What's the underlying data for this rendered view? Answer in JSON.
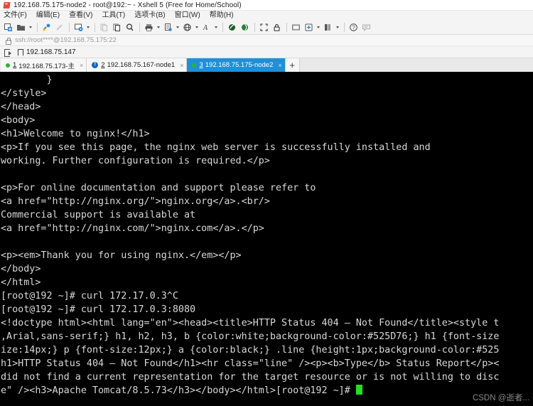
{
  "window": {
    "title": "192.168.75.175-node2 - root@192:~ - Xshell 5 (Free for Home/School)",
    "app_icon": "xshell-icon"
  },
  "menu": {
    "items": [
      {
        "label": "文件(F)",
        "name": "menu-file"
      },
      {
        "label": "编辑(E)",
        "name": "menu-edit"
      },
      {
        "label": "查看(V)",
        "name": "menu-view"
      },
      {
        "label": "工具(T)",
        "name": "menu-tools"
      },
      {
        "label": "选项卡(B)",
        "name": "menu-tabs"
      },
      {
        "label": "窗口(W)",
        "name": "menu-window"
      },
      {
        "label": "帮助(H)",
        "name": "menu-help"
      }
    ]
  },
  "toolbar": {
    "icons": [
      "new-session-icon",
      "open-folder-icon",
      "connect-icon",
      "disconnect-icon",
      "session-properties-icon",
      "copy-icon",
      "paste-icon",
      "find-icon",
      "print-icon",
      "log-icon",
      "globe-icon",
      "font-icon",
      "transfer-icon",
      "sftp-icon",
      "fullscreen-icon",
      "lock-icon",
      "compose-icon",
      "add-icon",
      "layout-icon",
      "help-icon",
      "chat-icon"
    ]
  },
  "address_bar": {
    "lock_icon": "lock-icon",
    "value": "ssh://root****@192.168.75.175:22",
    "placeholder": "ssh://host:port"
  },
  "bookmark_bar": {
    "open_icon": "open-session-icon",
    "flag_icon": "bookmark-flag-icon",
    "label": "192.168.75.147"
  },
  "tabs": {
    "add_label": "+",
    "close_label": "×",
    "items": [
      {
        "num": "1",
        "label": "192.168.75.173-主",
        "state": "connected",
        "active": false
      },
      {
        "num": "2",
        "label": "192.168.75.167-node1",
        "state": "alert",
        "active": false
      },
      {
        "num": "3",
        "label": "192.168.75.175-node2",
        "state": "connected",
        "active": true
      }
    ]
  },
  "terminal": {
    "background": "#000000",
    "foreground": "#d8d8d8",
    "cursor_color": "#22e022",
    "lines": [
      "        }",
      "</style>",
      "</head>",
      "<body>",
      "<h1>Welcome to nginx!</h1>",
      "<p>If you see this page, the nginx web server is successfully installed and",
      "working. Further configuration is required.</p>",
      "",
      "<p>For online documentation and support please refer to",
      "<a href=\"http://nginx.org/\">nginx.org</a>.<br/>",
      "Commercial support is available at",
      "<a href=\"http://nginx.com/\">nginx.com</a>.</p>",
      "",
      "<p><em>Thank you for using nginx.</em></p>",
      "</body>",
      "</html>",
      "[root@192 ~]# curl 172.17.0.3^C",
      "[root@192 ~]# curl 172.17.0.3:8080",
      "<!doctype html><html lang=\"en\"><head><title>HTTP Status 404 – Not Found</title><style t",
      ",Arial,sans-serif;} h1, h2, h3, b {color:white;background-color:#525D76;} h1 {font-size",
      "ize:14px;} p {font-size:12px;} a {color:black;} .line {height:1px;background-color:#525",
      "h1>HTTP Status 404 – Not Found</h1><hr class=\"line\" /><p><b>Type</b> Status Report</p><",
      "did not find a current representation for the target resource or is not willing to disc",
      "e\" /><h3>Apache Tomcat/8.5.73</h3></body></html>[root@192 ~]# "
    ],
    "watermark": "CSDN @逝者..."
  }
}
